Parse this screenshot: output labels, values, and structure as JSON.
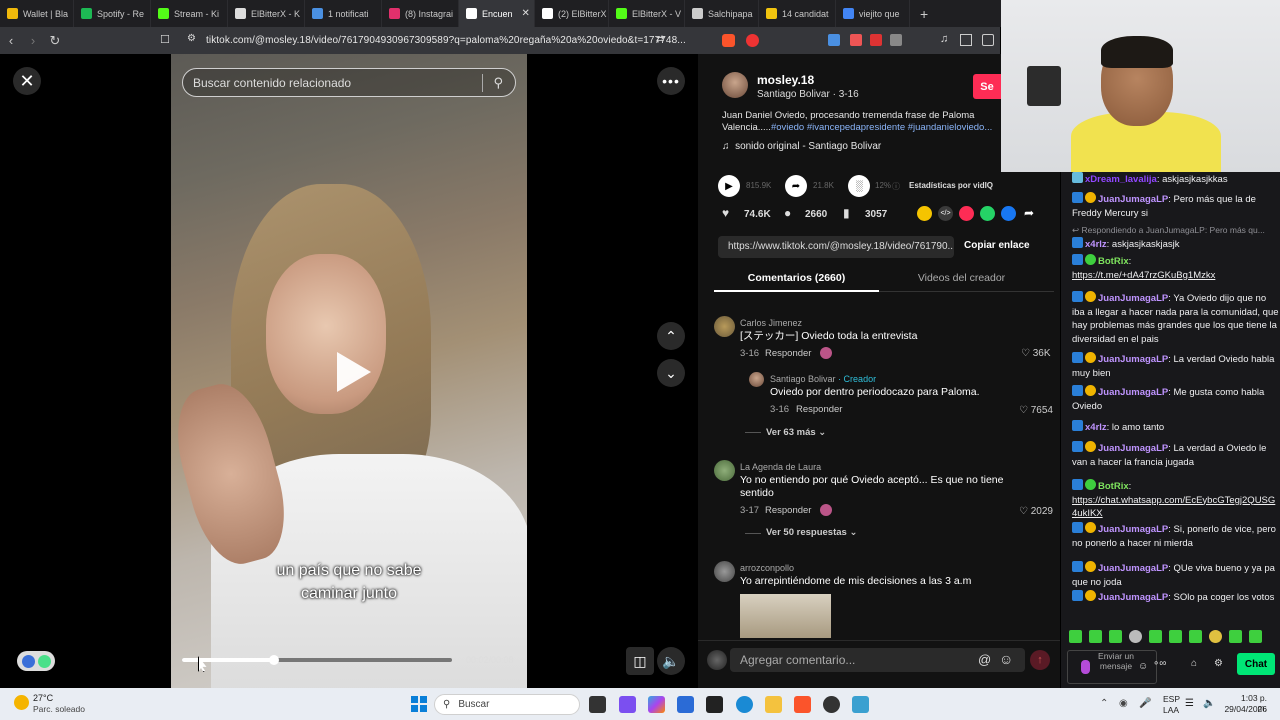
{
  "tabs": [
    {
      "label": "Wallet | Bla",
      "color": "#f0b90b"
    },
    {
      "label": "Spotify - Re",
      "color": "#1db954"
    },
    {
      "label": "Stream - Ki",
      "color": "#53fc18"
    },
    {
      "label": "ElBitterX - K",
      "color": "#dddddd"
    },
    {
      "label": "1 notificati",
      "color": "#4a90e2"
    },
    {
      "label": "(8) Instagrai",
      "color": "#e1306c"
    },
    {
      "label": "Encuen",
      "color": "#ffffff",
      "active": true
    },
    {
      "label": "(2) ElBitterX",
      "color": "#ffffff"
    },
    {
      "label": "ElBitterX - V",
      "color": "#53fc18"
    },
    {
      "label": "Salchipapa",
      "color": "#cccccc"
    },
    {
      "label": "14 candidat",
      "color": "#f1c40f"
    },
    {
      "label": "viejito que",
      "color": "#4285f4"
    }
  ],
  "address": {
    "url": "tiktok.com/@mosley.18/video/7617904930967309589?q=paloma%20regaña%20a%20oviedo&t=177748..."
  },
  "video": {
    "search_placeholder": "Buscar contenido relacionado",
    "subtitle_line1": "un país que no sabe",
    "subtitle_line2": "caminar junto",
    "time": "00:02/00:08",
    "progress_fraction": 0.25
  },
  "post": {
    "author": "mosley.18",
    "author_sub": "Santiago Bolivar · 3-16",
    "follow": "Se",
    "desc_text": "Juan Daniel Oviedo, procesando tremenda frase de Paloma Valencia.....",
    "desc_tags": "#oviedo #ivancepedapresidente #juandanieloviedo...",
    "sound": "sonido original - Santiago Bolivar",
    "plays": "815.9K",
    "shares_stat": "21.8K",
    "pct": "12%",
    "stats_label": "Estadísticas por vidIQ",
    "likes": "74.6K",
    "comments": "2660",
    "saves": "3057",
    "link": "https://www.tiktok.com/@mosley.18/video/761790...",
    "copy_label": "Copiar enlace",
    "tab_comments": "Comentarios (2660)",
    "tab_videos": "Videos del creador",
    "comment_placeholder": "Agregar comentario..."
  },
  "comments": [
    {
      "name": "Carlos Jimenez",
      "text": "[ステッカー] Oviedo toda la entrevista",
      "date": "3-16",
      "reply": "Responder",
      "likes": "36K"
    },
    {
      "name": "Santiago Bolivar",
      "creator": "· Creador",
      "text": "Oviedo por dentro periodocazo para Paloma.",
      "date": "3-16",
      "reply": "Responder",
      "likes": "7654"
    },
    {
      "more": "Ver 63 más"
    },
    {
      "name": "La Agenda de Laura",
      "text": "Yo no entiendo por qué Oviedo aceptó... Es que no tiene sentido",
      "date": "3-17",
      "reply": "Responder",
      "likes": "2029"
    },
    {
      "more": "Ver 50 respuestas"
    },
    {
      "name": "arrozconpollo",
      "text": "Yo arrepintiéndome de mis decisiones a las 3 a.m"
    }
  ],
  "chat": [
    {
      "user": "xDream_lavalija",
      "text": ": askjasjkasjkkas"
    },
    {
      "user": "JuanJumagaLP",
      "text": ": Pero más que la de Freddy Mercury si"
    },
    {
      "reply_note": "Respondiendo a JuanJumagaLP: Pero más qu..."
    },
    {
      "user": "x4rlz",
      "text": ": askjasjkaskjasjk"
    },
    {
      "user": "BotRix",
      "text": ":",
      "link": "https://t.me/+dA47rzGKuBg1Mzkx"
    },
    {
      "user": "JuanJumagaLP",
      "text": ": Ya Oviedo dijo que no iba a llegar a hacer nada para la comunidad, que hay problemas más grandes que los que tiene la diversidad en el pais"
    },
    {
      "user": "JuanJumagaLP",
      "text": ": La verdad Oviedo habla muy bien"
    },
    {
      "user": "JuanJumagaLP",
      "text": ": Me gusta como habla Oviedo"
    },
    {
      "user": "x4rlz",
      "text": ": lo amo tanto"
    },
    {
      "user": "JuanJumagaLP",
      "text": ": La verdad a Oviedo le van a hacer la francia jugada"
    },
    {
      "user": "BotRix",
      "text": ":",
      "link": "https://chat.whatsapp.com/EcEybcGTegj2QUSG4ukIKX"
    },
    {
      "user": "JuanJumagaLP",
      "text": ": Si, ponerlo de vice, pero no ponerlo a hacer ni mierda"
    },
    {
      "user": "JuanJumagaLP",
      "text": ": QUe viva bueno y ya pa que no joda"
    },
    {
      "user": "JuanJumagaLP",
      "text": ": SOlo pa coger los votos"
    }
  ],
  "chat_input": {
    "placeholder": "Enviar un mensaje",
    "send": "Chat"
  },
  "taskbar": {
    "weather_temp": "27°C",
    "weather_desc": "Parc. soleado",
    "search": "Buscar",
    "lang1": "ESP",
    "lang2": "LAA",
    "time": "1:03 p. m.",
    "date": "29/04/2026"
  }
}
